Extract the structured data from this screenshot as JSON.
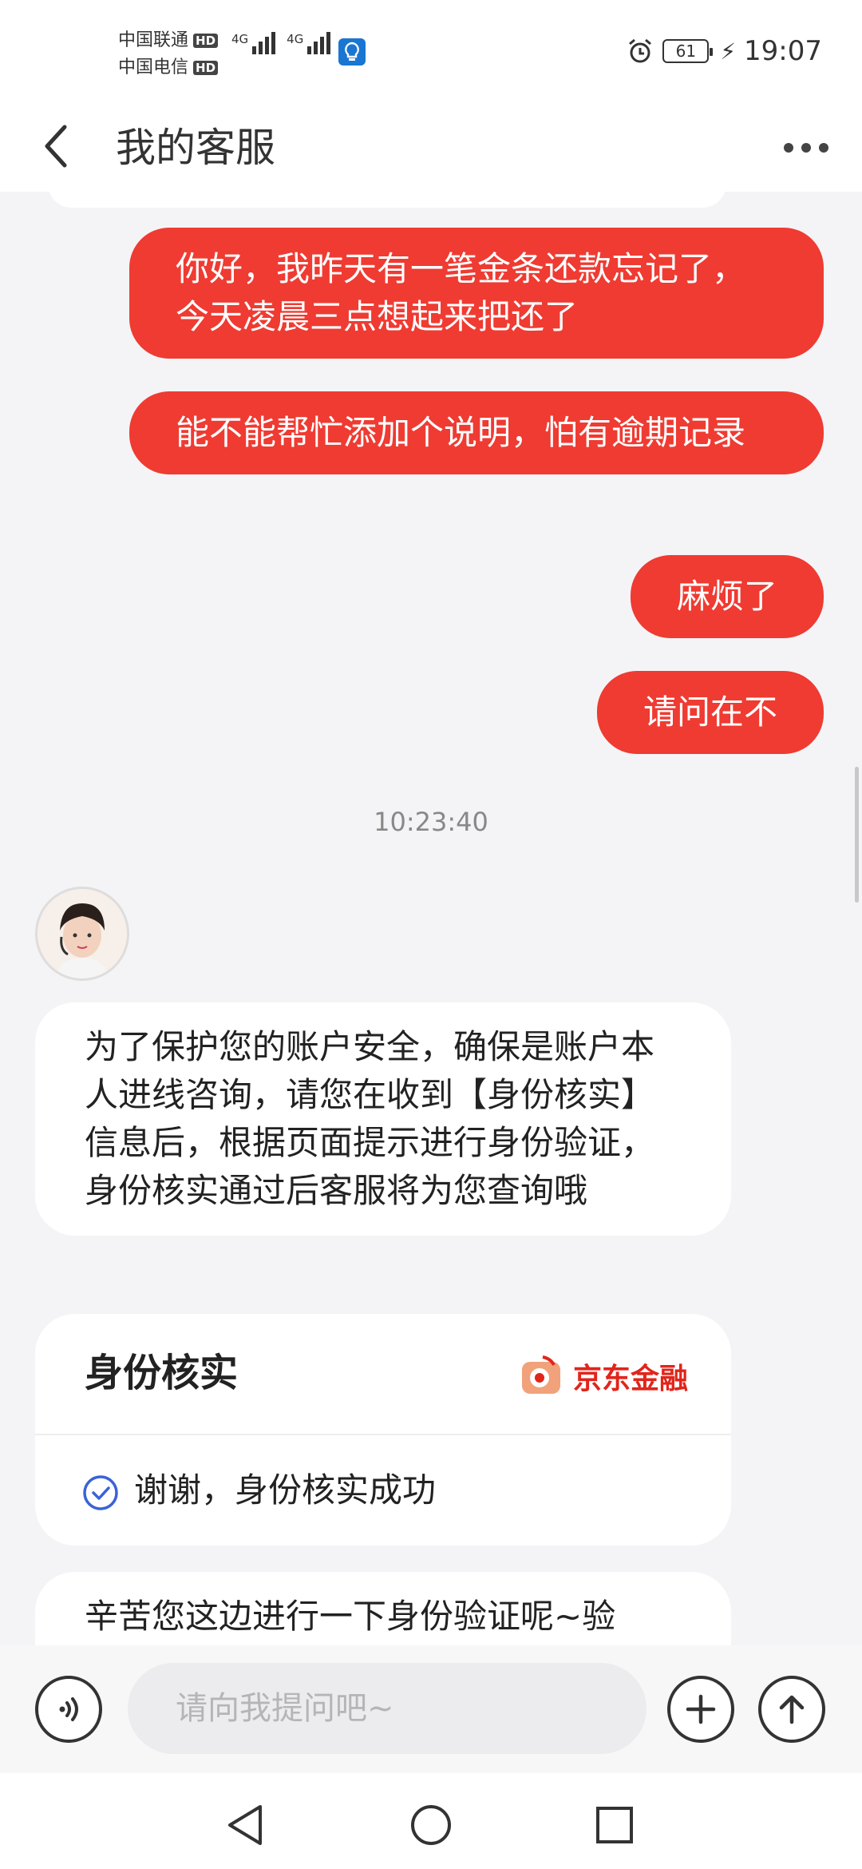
{
  "status_bar": {
    "carrier_1": "中国联通",
    "carrier_2": "中国电信",
    "hd_label": "HD",
    "network_type": "4G",
    "battery_level": "61",
    "time": "19:07"
  },
  "header": {
    "title": "我的客服"
  },
  "messages": {
    "outgoing": [
      "你好，我昨天有一笔金条还款忘记了，今天凌晨三点想起来把还了",
      "能不能帮忙添加个说明，怕有逾期记录",
      "麻烦了",
      "请问在不"
    ],
    "timestamp": "10:23:40",
    "incoming_text": "为了保护您的账户安全，确保是账户本人进线咨询，请您在收到【身份核实】信息后，根据页面提示进行身份验证，身份核实通过后客服将为您查询哦",
    "verification_card": {
      "title": "身份核实",
      "brand": "京东金融",
      "status_text": "谢谢，身份核实成功"
    },
    "partial_text": "辛苦您这边进行一下身份验证呢~验"
  },
  "input_bar": {
    "placeholder": "请向我提问吧~"
  },
  "colors": {
    "accent": "#ef3b32",
    "brand": "#e1251b",
    "check": "#3a62d8"
  },
  "icons": [
    "back-icon",
    "more-icon",
    "alarm-icon",
    "voice-icon",
    "plus-icon",
    "send-icon",
    "nav-back-icon",
    "nav-home-icon",
    "nav-recent-icon",
    "check-icon",
    "jd-logo-icon"
  ]
}
